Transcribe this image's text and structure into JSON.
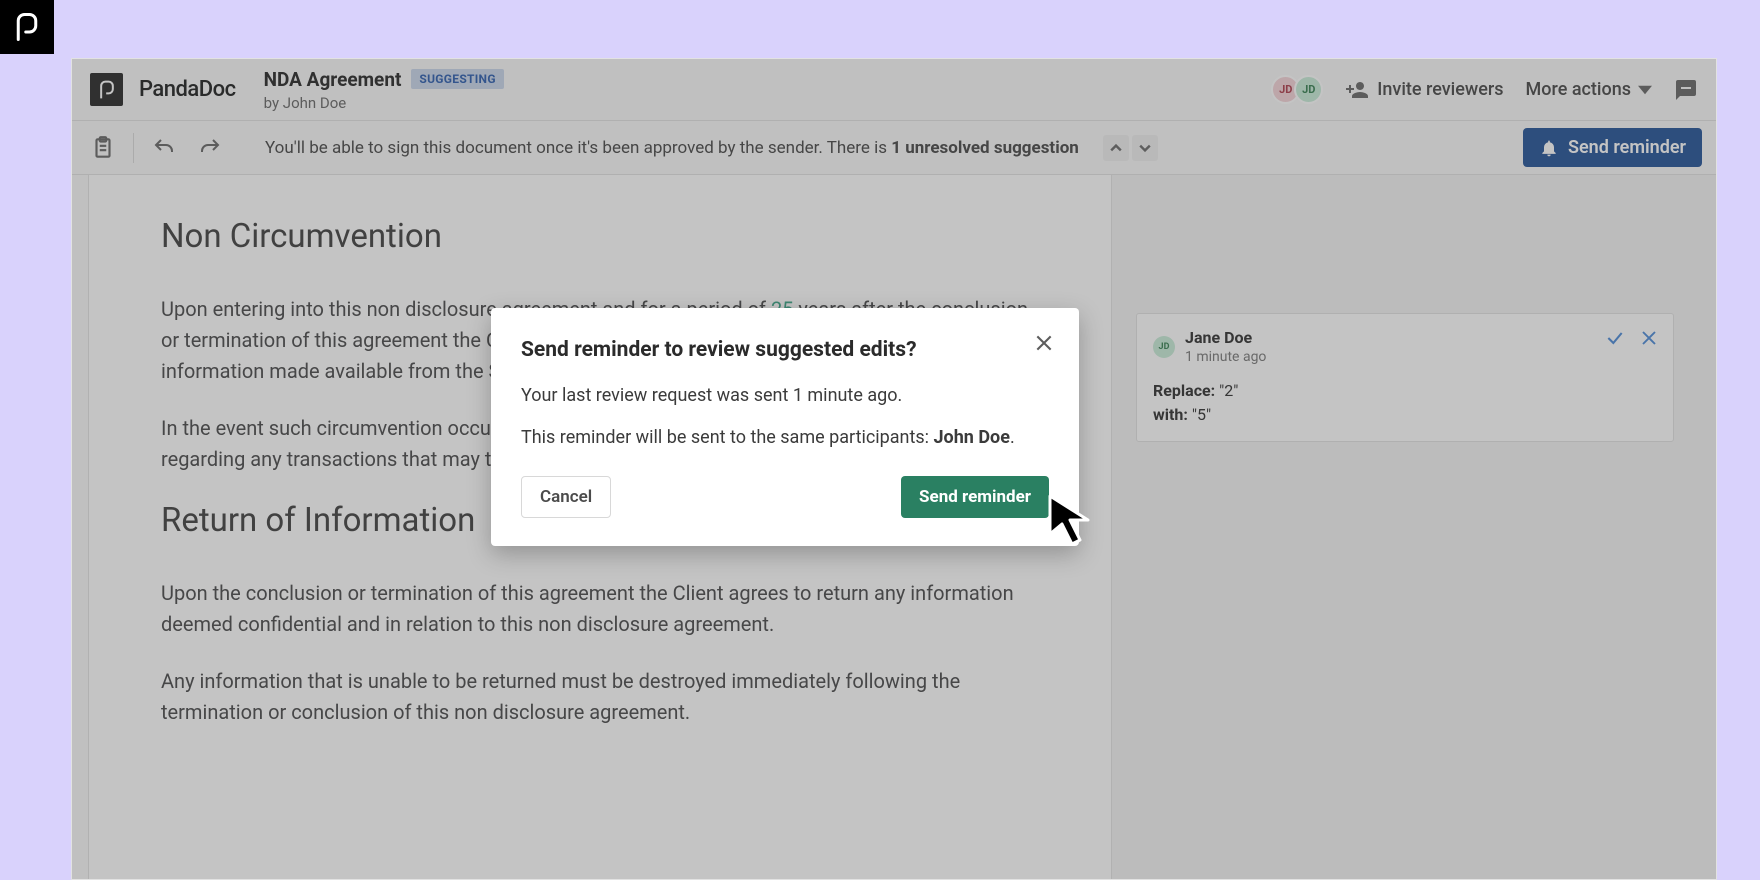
{
  "brand": {
    "name": "PandaDoc"
  },
  "doc": {
    "title": "NDA Agreement",
    "status_badge": "SUGGESTING",
    "author_prefix": "by ",
    "author": "John Doe"
  },
  "header": {
    "avatar1": "JD",
    "avatar2": "JD",
    "invite_label": "Invite reviewers",
    "more_label": "More actions"
  },
  "toolbar": {
    "status_text_a": "You'll be able to sign this document once it's been approved by the sender. There is ",
    "status_text_b": "1 unresolved suggestion",
    "send_reminder": "Send reminder"
  },
  "page": {
    "h1": "Non Circumvention",
    "p1a": "Upon entering into this non disclosure agreement and for a period of ",
    "p1_edit": "25",
    "p1b": " years after the conclusion or termination of this agreement the Client agrees not to circumvent or interfere with any information made available from the Sender to the Client.",
    "p2": "In the event such circumvention occurs the Sender will be entitled to any and all compensation regarding any transactions that may take place from such.",
    "h2": "Return of Information",
    "p3": "Upon the conclusion or termination of this agreement the Client agrees to return any information deemed confidential and in relation to this non disclosure agreement.",
    "p4": "Any information that is unable to be returned must be destroyed immediately following the termination or conclusion of this non disclosure agreement."
  },
  "suggestion": {
    "name": "Jane Doe",
    "initials": "JD",
    "time": "1 minute ago",
    "label_replace": "Replace:",
    "val_replace": " \"2\"",
    "label_with": "with:",
    "val_with": " \"5\""
  },
  "modal": {
    "title": "Send reminder to review suggested edits?",
    "line1": "Your last review request was sent 1 minute ago.",
    "line2a": "This reminder will be sent to the same participants: ",
    "line2b": "John Doe",
    "line2c": ".",
    "cancel": "Cancel",
    "confirm": "Send reminder"
  }
}
